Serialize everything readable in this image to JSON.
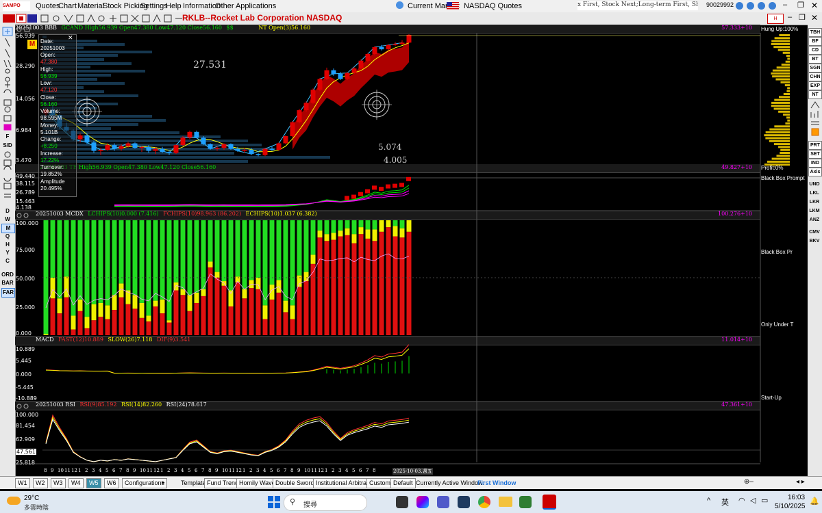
{
  "menu": {
    "logo": "SAMPO",
    "items": [
      "Quotes",
      "Chart",
      "Material",
      "Stock Picking",
      "Settings",
      "Help",
      "Information",
      "Other Applications"
    ],
    "current_market_label": "Current Market:",
    "market": "NASDAQ Quotes",
    "ticker_text": "x First, Stock Next;Long-term First, Short-term Next;",
    "account": "90029992"
  },
  "title": "RKLB--Rocket Lab Corporation  NASDAQ",
  "main_panel": {
    "header": [
      "20251003 BBB",
      "GCAND High56.939 Open47.380 Low47.120 Close56.160",
      "$$",
      "NT Open(3)56.160"
    ],
    "right_value": "57.333+10",
    "right_label": "Hung Up:100%",
    "y_labels": [
      "56.939",
      "28.290",
      "14.056",
      "6.984",
      "3.470"
    ],
    "annot_high": "27.531",
    "annot_a": "5.074",
    "annot_b": "4.005"
  },
  "info_box": {
    "date_label": "Date:",
    "date": "20251003",
    "open_label": "Open:",
    "open": "47.380",
    "high_label": "High:",
    "high": "56.939",
    "low_label": "Low:",
    "low": "47.120",
    "close_label": "Close:",
    "close": "56.160",
    "volume_label": "Volume:",
    "volume": "98.595M",
    "money_label": "Money:",
    "money": "5.101B",
    "change_label": "Change:",
    "change": "+8.250",
    "increase_label": "Increase:",
    "increase": "17.22%",
    "turnover_label": "Turnover:",
    "turnover": "19.852%",
    "amplitude_label": "Amplitude",
    "amplitude": "20.495%"
  },
  "sub1": {
    "header": "20251003 TE High56.939 Open47.380 Low47.120 Close56.160",
    "right_value": "49.827+10",
    "right_label": "Profit:0%",
    "y_labels": [
      "49.440",
      "38.115",
      "26.789",
      "15.463",
      "4.138"
    ]
  },
  "mcdx": {
    "header": [
      "20251003 MCDX",
      "LCHIPS(10)0.000 (7.416)",
      "FCHIPS(10)98.963 (86.202)",
      "ECHIPS(10)1.037 (6.382)"
    ],
    "right_value": "100.276+10",
    "y_labels": [
      "100.000",
      "75.000",
      "50.000",
      "25.000",
      "0.000"
    ]
  },
  "macd": {
    "header": [
      "MACD",
      "FAST(12)10.889",
      "SLOW(26)7.118",
      "DIF(9)3.541"
    ],
    "right_value": "11.014+10",
    "y_labels": [
      "10.889",
      "5.445",
      "0.000",
      "-5.445",
      "-10.889"
    ]
  },
  "rsi": {
    "header": [
      "20251003 RSI",
      "RSI(9)85.192",
      "RSI(14)82.260",
      "RSI(24)78.617"
    ],
    "right_value": "47.361+10",
    "y_labels": [
      "100.000",
      "81.454",
      "62.909",
      "47.561",
      "25.818"
    ]
  },
  "right_side_labels": [
    "Black Box Prompt",
    "Black Box Pr",
    "Only Under T",
    "Start-Up"
  ],
  "right_toolbar": [
    "TBH",
    "BF",
    "CD",
    "BT",
    "SGN",
    "CHN",
    "EXP",
    "NT",
    "PRT",
    "SET",
    "IND",
    "Axis",
    "UND",
    "LKL",
    "LKR",
    "LKM",
    "ANZ",
    "CMV",
    "BKV"
  ],
  "left_toolbar": [
    "F",
    "S/D",
    "D",
    "W",
    "M",
    "Q",
    "H",
    "Y",
    "C",
    "ORD",
    "BAR",
    "FAR"
  ],
  "x_axis": {
    "ticks": [
      "8",
      "9",
      "10",
      "11",
      "12",
      "1",
      "2",
      "3",
      "4",
      "5",
      "6",
      "7",
      "8",
      "9",
      "10",
      "11",
      "12",
      "1",
      "2",
      "3",
      "4",
      "5",
      "6",
      "7",
      "8",
      "9",
      "10",
      "11",
      "12",
      "1",
      "2",
      "3",
      "4",
      "5",
      "6",
      "7",
      "8",
      "9",
      "10",
      "11",
      "12",
      "1",
      "2",
      "3",
      "4",
      "5",
      "6",
      "7",
      "8"
    ],
    "end_label": "2025-10-03,週五"
  },
  "bottom": {
    "tabs": [
      "W1",
      "W2",
      "W3",
      "W4",
      "W5",
      "W6"
    ],
    "active_tab": "W5",
    "config": "Configurations",
    "template_label": "Template:",
    "templates": [
      "Fund Trend",
      "Homily Wave",
      "Double Swords",
      "Institutional Arbitrage",
      "Custom",
      "Default"
    ],
    "active_window_label": "Currently Active Window:",
    "active_window": "First Window"
  },
  "taskbar": {
    "temp": "29°C",
    "weather": "多雲時陰",
    "search": "搜尋",
    "ime": "英",
    "time": "16:03",
    "date": "5/10/2025"
  },
  "colors": {
    "up": "#e00000",
    "down": "#1ea0ff",
    "green": "#00e000",
    "yellow": "#ffff00",
    "magenta": "#ff00ff"
  },
  "mcdx_data": {
    "red": [
      0,
      32,
      19,
      33,
      5,
      21,
      6,
      13,
      16,
      14,
      22,
      33,
      27,
      23,
      15,
      12,
      25,
      19,
      11,
      39,
      35,
      21,
      28,
      34,
      59,
      50,
      43,
      25,
      46,
      32,
      41,
      40,
      14,
      31,
      37,
      20,
      14,
      42,
      47,
      62,
      85,
      82,
      83,
      86,
      87,
      80,
      88,
      84,
      82,
      90,
      94,
      86,
      85,
      90
    ],
    "yellow": [
      1,
      18,
      13,
      18,
      12,
      10,
      10,
      14,
      12,
      12,
      13,
      12,
      12,
      12,
      13,
      5,
      5,
      12,
      2,
      7,
      5,
      14,
      9,
      6,
      5,
      5,
      4,
      14,
      5,
      8,
      7,
      10,
      12,
      13,
      11,
      10,
      12,
      10,
      8,
      8,
      6,
      6,
      6,
      5,
      6,
      8,
      6,
      8,
      10,
      10,
      6,
      9,
      8,
      10
    ],
    "green": [
      99,
      50,
      68,
      49,
      83,
      69,
      84,
      73,
      72,
      74,
      65,
      55,
      61,
      65,
      72,
      83,
      70,
      69,
      87,
      54,
      60,
      65,
      63,
      60,
      36,
      45,
      53,
      61,
      49,
      60,
      52,
      50,
      74,
      56,
      52,
      70,
      74,
      48,
      45,
      30,
      9,
      12,
      11,
      9,
      7,
      12,
      6,
      8,
      8,
      0,
      0,
      5,
      7,
      0
    ]
  },
  "candles": [
    [
      10.2,
      11.5,
      9.6,
      11.0
    ],
    [
      11.0,
      12.1,
      9.5,
      9.8
    ],
    [
      9.8,
      10.0,
      7.2,
      7.6
    ],
    [
      7.6,
      8.3,
      6.8,
      7.0
    ],
    [
      7.0,
      7.2,
      5.6,
      5.8
    ],
    [
      5.8,
      6.6,
      5.4,
      6.3
    ],
    [
      6.3,
      6.6,
      5.2,
      5.4
    ],
    [
      5.4,
      5.6,
      4.3,
      4.5
    ],
    [
      4.5,
      4.8,
      4.1,
      4.6
    ],
    [
      4.6,
      5.3,
      4.5,
      5.1
    ],
    [
      5.1,
      5.3,
      4.5,
      4.7
    ],
    [
      4.7,
      5.2,
      4.5,
      5.0
    ],
    [
      5.0,
      5.5,
      4.8,
      5.3
    ],
    [
      5.3,
      5.4,
      4.7,
      4.8
    ],
    [
      4.8,
      5.0,
      4.4,
      4.9
    ],
    [
      4.9,
      5.1,
      4.3,
      4.5
    ],
    [
      4.5,
      4.9,
      4.2,
      4.7
    ],
    [
      4.7,
      4.9,
      4.3,
      4.4
    ],
    [
      4.4,
      4.6,
      4.1,
      4.3
    ],
    [
      4.3,
      5.2,
      4.2,
      5.1
    ],
    [
      5.1,
      6.2,
      5.0,
      6.0
    ],
    [
      6.0,
      7.0,
      5.8,
      6.8
    ],
    [
      6.8,
      7.0,
      5.9,
      6.0
    ],
    [
      6.0,
      6.2,
      5.1,
      5.2
    ],
    [
      5.2,
      5.3,
      4.6,
      4.7
    ],
    [
      4.7,
      5.0,
      4.5,
      4.8
    ],
    [
      4.8,
      5.3,
      4.6,
      5.2
    ],
    [
      5.2,
      5.3,
      4.6,
      4.7
    ],
    [
      4.7,
      4.9,
      4.4,
      4.5
    ],
    [
      4.5,
      4.8,
      4.3,
      4.6
    ],
    [
      4.6,
      4.8,
      4.1,
      4.2
    ],
    [
      4.2,
      4.3,
      4.0,
      4.1
    ],
    [
      4.1,
      4.8,
      4.0,
      4.7
    ],
    [
      4.7,
      5.0,
      4.5,
      4.6
    ],
    [
      4.6,
      5.4,
      4.5,
      5.3
    ],
    [
      5.3,
      6.3,
      5.2,
      6.2
    ],
    [
      6.2,
      8.6,
      6.1,
      8.4
    ],
    [
      8.4,
      11.2,
      8.2,
      10.9
    ],
    [
      10.9,
      13.2,
      10.5,
      12.8
    ],
    [
      12.8,
      17.5,
      12.5,
      17.0
    ],
    [
      17.0,
      22.0,
      16.5,
      21.5
    ],
    [
      21.5,
      27.5,
      21.0,
      26.0
    ],
    [
      26.0,
      27.0,
      23.0,
      24.0
    ],
    [
      24.0,
      25.0,
      21.0,
      21.5
    ],
    [
      21.5,
      25.0,
      21.0,
      24.5
    ],
    [
      24.5,
      28.0,
      24.0,
      27.0
    ],
    [
      27.0,
      33.0,
      26.5,
      32.0
    ],
    [
      32.0,
      38.0,
      31.0,
      37.0
    ],
    [
      37.0,
      44.0,
      36.0,
      43.0
    ],
    [
      43.0,
      45.0,
      40.0,
      41.0
    ],
    [
      41.0,
      46.0,
      40.0,
      45.0
    ],
    [
      45.0,
      48.0,
      44.0,
      46.0
    ],
    [
      46.0,
      50.0,
      45.0,
      47.4
    ],
    [
      47.4,
      56.9,
      47.1,
      56.2
    ]
  ]
}
